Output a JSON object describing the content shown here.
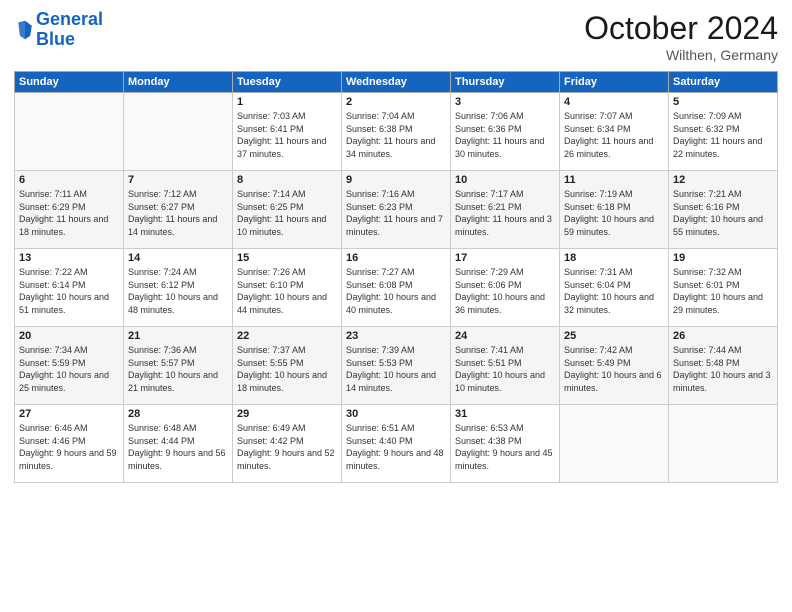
{
  "logo": {
    "line1": "General",
    "line2": "Blue"
  },
  "title": "October 2024",
  "subtitle": "Wilthen, Germany",
  "days_header": [
    "Sunday",
    "Monday",
    "Tuesday",
    "Wednesday",
    "Thursday",
    "Friday",
    "Saturday"
  ],
  "weeks": [
    [
      {
        "day": "",
        "sunrise": "",
        "sunset": "",
        "daylight": ""
      },
      {
        "day": "",
        "sunrise": "",
        "sunset": "",
        "daylight": ""
      },
      {
        "day": "1",
        "sunrise": "Sunrise: 7:03 AM",
        "sunset": "Sunset: 6:41 PM",
        "daylight": "Daylight: 11 hours and 37 minutes."
      },
      {
        "day": "2",
        "sunrise": "Sunrise: 7:04 AM",
        "sunset": "Sunset: 6:38 PM",
        "daylight": "Daylight: 11 hours and 34 minutes."
      },
      {
        "day": "3",
        "sunrise": "Sunrise: 7:06 AM",
        "sunset": "Sunset: 6:36 PM",
        "daylight": "Daylight: 11 hours and 30 minutes."
      },
      {
        "day": "4",
        "sunrise": "Sunrise: 7:07 AM",
        "sunset": "Sunset: 6:34 PM",
        "daylight": "Daylight: 11 hours and 26 minutes."
      },
      {
        "day": "5",
        "sunrise": "Sunrise: 7:09 AM",
        "sunset": "Sunset: 6:32 PM",
        "daylight": "Daylight: 11 hours and 22 minutes."
      }
    ],
    [
      {
        "day": "6",
        "sunrise": "Sunrise: 7:11 AM",
        "sunset": "Sunset: 6:29 PM",
        "daylight": "Daylight: 11 hours and 18 minutes."
      },
      {
        "day": "7",
        "sunrise": "Sunrise: 7:12 AM",
        "sunset": "Sunset: 6:27 PM",
        "daylight": "Daylight: 11 hours and 14 minutes."
      },
      {
        "day": "8",
        "sunrise": "Sunrise: 7:14 AM",
        "sunset": "Sunset: 6:25 PM",
        "daylight": "Daylight: 11 hours and 10 minutes."
      },
      {
        "day": "9",
        "sunrise": "Sunrise: 7:16 AM",
        "sunset": "Sunset: 6:23 PM",
        "daylight": "Daylight: 11 hours and 7 minutes."
      },
      {
        "day": "10",
        "sunrise": "Sunrise: 7:17 AM",
        "sunset": "Sunset: 6:21 PM",
        "daylight": "Daylight: 11 hours and 3 minutes."
      },
      {
        "day": "11",
        "sunrise": "Sunrise: 7:19 AM",
        "sunset": "Sunset: 6:18 PM",
        "daylight": "Daylight: 10 hours and 59 minutes."
      },
      {
        "day": "12",
        "sunrise": "Sunrise: 7:21 AM",
        "sunset": "Sunset: 6:16 PM",
        "daylight": "Daylight: 10 hours and 55 minutes."
      }
    ],
    [
      {
        "day": "13",
        "sunrise": "Sunrise: 7:22 AM",
        "sunset": "Sunset: 6:14 PM",
        "daylight": "Daylight: 10 hours and 51 minutes."
      },
      {
        "day": "14",
        "sunrise": "Sunrise: 7:24 AM",
        "sunset": "Sunset: 6:12 PM",
        "daylight": "Daylight: 10 hours and 48 minutes."
      },
      {
        "day": "15",
        "sunrise": "Sunrise: 7:26 AM",
        "sunset": "Sunset: 6:10 PM",
        "daylight": "Daylight: 10 hours and 44 minutes."
      },
      {
        "day": "16",
        "sunrise": "Sunrise: 7:27 AM",
        "sunset": "Sunset: 6:08 PM",
        "daylight": "Daylight: 10 hours and 40 minutes."
      },
      {
        "day": "17",
        "sunrise": "Sunrise: 7:29 AM",
        "sunset": "Sunset: 6:06 PM",
        "daylight": "Daylight: 10 hours and 36 minutes."
      },
      {
        "day": "18",
        "sunrise": "Sunrise: 7:31 AM",
        "sunset": "Sunset: 6:04 PM",
        "daylight": "Daylight: 10 hours and 32 minutes."
      },
      {
        "day": "19",
        "sunrise": "Sunrise: 7:32 AM",
        "sunset": "Sunset: 6:01 PM",
        "daylight": "Daylight: 10 hours and 29 minutes."
      }
    ],
    [
      {
        "day": "20",
        "sunrise": "Sunrise: 7:34 AM",
        "sunset": "Sunset: 5:59 PM",
        "daylight": "Daylight: 10 hours and 25 minutes."
      },
      {
        "day": "21",
        "sunrise": "Sunrise: 7:36 AM",
        "sunset": "Sunset: 5:57 PM",
        "daylight": "Daylight: 10 hours and 21 minutes."
      },
      {
        "day": "22",
        "sunrise": "Sunrise: 7:37 AM",
        "sunset": "Sunset: 5:55 PM",
        "daylight": "Daylight: 10 hours and 18 minutes."
      },
      {
        "day": "23",
        "sunrise": "Sunrise: 7:39 AM",
        "sunset": "Sunset: 5:53 PM",
        "daylight": "Daylight: 10 hours and 14 minutes."
      },
      {
        "day": "24",
        "sunrise": "Sunrise: 7:41 AM",
        "sunset": "Sunset: 5:51 PM",
        "daylight": "Daylight: 10 hours and 10 minutes."
      },
      {
        "day": "25",
        "sunrise": "Sunrise: 7:42 AM",
        "sunset": "Sunset: 5:49 PM",
        "daylight": "Daylight: 10 hours and 6 minutes."
      },
      {
        "day": "26",
        "sunrise": "Sunrise: 7:44 AM",
        "sunset": "Sunset: 5:48 PM",
        "daylight": "Daylight: 10 hours and 3 minutes."
      }
    ],
    [
      {
        "day": "27",
        "sunrise": "Sunrise: 6:46 AM",
        "sunset": "Sunset: 4:46 PM",
        "daylight": "Daylight: 9 hours and 59 minutes."
      },
      {
        "day": "28",
        "sunrise": "Sunrise: 6:48 AM",
        "sunset": "Sunset: 4:44 PM",
        "daylight": "Daylight: 9 hours and 56 minutes."
      },
      {
        "day": "29",
        "sunrise": "Sunrise: 6:49 AM",
        "sunset": "Sunset: 4:42 PM",
        "daylight": "Daylight: 9 hours and 52 minutes."
      },
      {
        "day": "30",
        "sunrise": "Sunrise: 6:51 AM",
        "sunset": "Sunset: 4:40 PM",
        "daylight": "Daylight: 9 hours and 48 minutes."
      },
      {
        "day": "31",
        "sunrise": "Sunrise: 6:53 AM",
        "sunset": "Sunset: 4:38 PM",
        "daylight": "Daylight: 9 hours and 45 minutes."
      },
      {
        "day": "",
        "sunrise": "",
        "sunset": "",
        "daylight": ""
      },
      {
        "day": "",
        "sunrise": "",
        "sunset": "",
        "daylight": ""
      }
    ]
  ]
}
